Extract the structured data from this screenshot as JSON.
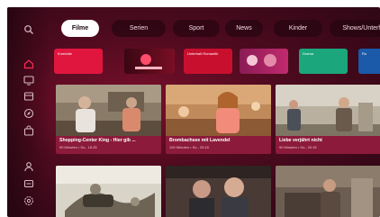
{
  "sidebar": {
    "items": [
      {
        "name": "search-icon"
      },
      {
        "name": "home-icon"
      },
      {
        "name": "tv-icon"
      },
      {
        "name": "library-icon"
      },
      {
        "name": "compass-icon"
      },
      {
        "name": "bag-icon"
      },
      {
        "name": "profile-icon"
      },
      {
        "name": "list-icon"
      },
      {
        "name": "settings-icon"
      }
    ],
    "active_color": "#ff2d55"
  },
  "tabs": [
    {
      "label": "Filme",
      "active": true
    },
    {
      "label": "Serien",
      "active": false
    },
    {
      "label": "Sport",
      "active": false
    },
    {
      "label": "News",
      "active": false
    },
    {
      "label": "Kinder",
      "active": false
    },
    {
      "label": "Shows/Unterhalt",
      "active": false
    }
  ],
  "channels": [
    {
      "label": "Komödie",
      "color": "#e0163e"
    },
    {
      "label": "",
      "color": "#7a0f24"
    },
    {
      "label": "Unterhalt Romantik",
      "color": "#c8102e"
    },
    {
      "label": "",
      "color": "#c12a6e"
    },
    {
      "label": "Drama",
      "color": "#1ba67b"
    },
    {
      "label": "Ro",
      "color": "#1a5aa8"
    }
  ],
  "programs": [
    {
      "title": "Shopping-Center King - Hier gib ...",
      "meta": "90 Minuten • So., 16:25"
    },
    {
      "title": "Brombachsee mit Lavendel",
      "meta": "100 Minuten • So., 20:15"
    },
    {
      "title": "Liebe verjährt nicht",
      "meta": "90 Minuten • So., 20:15"
    },
    {
      "title": "",
      "meta": ""
    },
    {
      "title": "",
      "meta": ""
    },
    {
      "title": "",
      "meta": ""
    }
  ]
}
